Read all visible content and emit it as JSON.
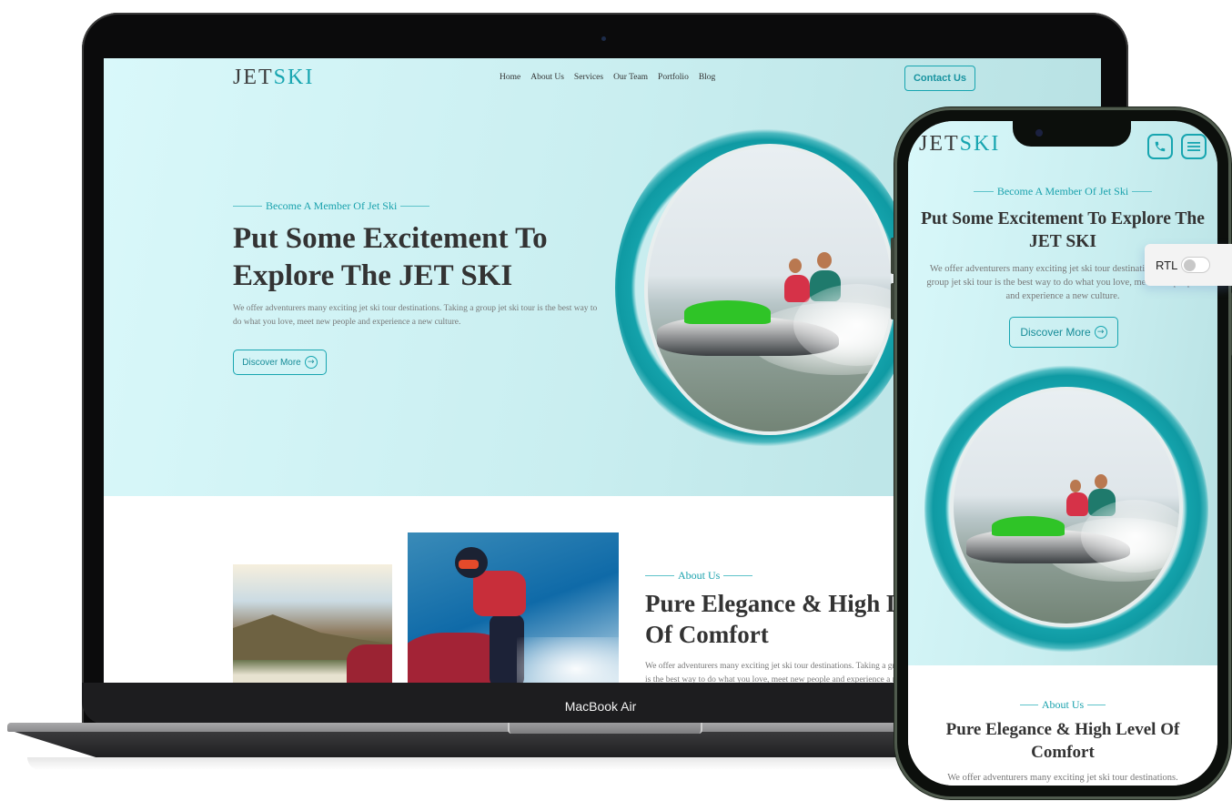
{
  "brand": {
    "logo_dark": "JET",
    "logo_accent": "SKI",
    "accent_color": "#17a5b0"
  },
  "desktop": {
    "nav": [
      "Home",
      "About Us",
      "Services",
      "Our Team",
      "Portfolio",
      "Blog"
    ],
    "contact_label": "Contact Us",
    "hero": {
      "eyebrow": "Become A Member Of Jet Ski",
      "title": "Put Some Excitement To Explore The JET SKI",
      "description": "We offer adventurers many exciting jet ski tour destinations. Taking a group jet ski tour is the best way to do what you love, meet new people and experience a new culture.",
      "button_label": "Discover More",
      "image_alt": "Couple riding green jet ski"
    },
    "about": {
      "eyebrow": "About Us",
      "title_line1": "Pure Elegance & High Level",
      "title_line2": "Of Comfort",
      "desc_line1": "We offer adventurers many exciting jet ski tour destinations. Taking a group jet ski tour",
      "desc_line2": "is the best way to do what you love, meet new people and experience a new culture.",
      "images": [
        "Jet ski near mountains at sunset",
        "Rider in helmet on red jet ski"
      ]
    }
  },
  "device": {
    "laptop_label": "MacBook Air"
  },
  "mobile": {
    "icons": [
      "phone-icon",
      "menu-icon"
    ],
    "hero": {
      "eyebrow": "Become A Member Of Jet Ski",
      "title": "Put Some Excitement To Explore The JET SKI",
      "description": "We offer adventurers many exciting jet ski tour destinations. Taking a group jet ski tour is the best way to do what you love, meet new people and experience a new culture.",
      "button_label": "Discover More"
    },
    "about": {
      "eyebrow": "About Us",
      "title": "Pure Elegance & High Level Of Comfort",
      "description": "We offer adventurers many exciting jet ski tour destinations."
    }
  },
  "rtl_toggle": {
    "label": "RTL",
    "enabled": false
  }
}
